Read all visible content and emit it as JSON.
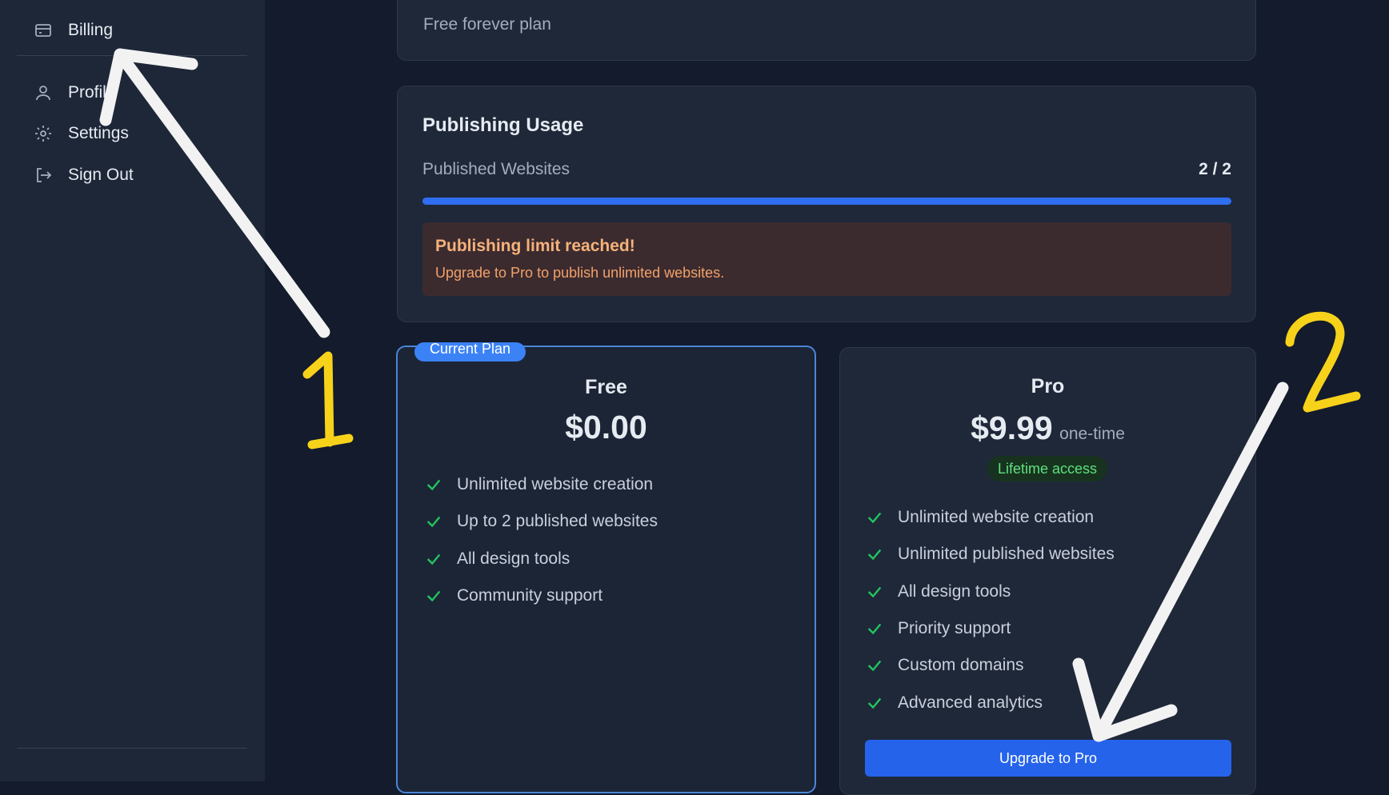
{
  "sidebar": {
    "items": [
      {
        "label": "Billing",
        "icon": "credit-card-icon"
      },
      {
        "label": "Profile",
        "icon": "user-icon"
      },
      {
        "label": "Settings",
        "icon": "gear-icon"
      },
      {
        "label": "Sign Out",
        "icon": "sign-out-icon"
      }
    ]
  },
  "plan_card": {
    "subtitle": "Free forever plan"
  },
  "usage": {
    "title": "Publishing Usage",
    "label": "Published Websites",
    "count": "2 / 2",
    "progress_fraction": 1.0,
    "alert_title": "Publishing limit reached!",
    "alert_body": "Upgrade to Pro to publish unlimited websites."
  },
  "plans": {
    "free": {
      "badge": "Current Plan",
      "name": "Free",
      "price": "$0.00",
      "features": [
        "Unlimited website creation",
        "Up to 2 published websites",
        "All design tools",
        "Community support"
      ]
    },
    "pro": {
      "name": "Pro",
      "price": "$9.99",
      "period": "one-time",
      "tag": "Lifetime access",
      "features": [
        "Unlimited website creation",
        "Unlimited published websites",
        "All design tools",
        "Priority support",
        "Custom domains",
        "Advanced analytics"
      ],
      "cta": "Upgrade to Pro"
    }
  },
  "annotations": {
    "marker_1": "1",
    "marker_2": "2"
  },
  "colors": {
    "accent": "#2563eb",
    "success": "#22c55e",
    "warning": "#f6b17a",
    "annotation_arrow": "#f2f2f2",
    "annotation_number": "#f7d21a"
  }
}
